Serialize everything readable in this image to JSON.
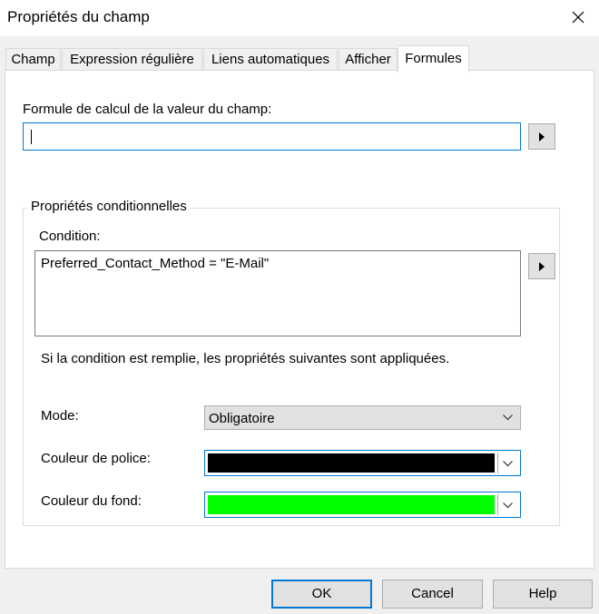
{
  "window": {
    "title": "Propriétés du champ"
  },
  "tabs": [
    {
      "label": "Champ"
    },
    {
      "label": "Expression régulière"
    },
    {
      "label": "Liens automatiques"
    },
    {
      "label": "Afficher"
    },
    {
      "label": "Formules"
    }
  ],
  "formula": {
    "label": "Formule de calcul de la valeur du champ:",
    "value": ""
  },
  "conditional": {
    "group_title": "Propriétés conditionnelles",
    "condition_label": "Condition:",
    "condition_value": "Preferred_Contact_Method = \"E-Mail\"",
    "info_text": "Si la condition est remplie, les propriétés suivantes sont appliquées.",
    "mode_label": "Mode:",
    "mode_value": "Obligatoire",
    "font_color_label": "Couleur de police:",
    "font_color": "#000000",
    "bg_color_label": "Couleur du fond:",
    "bg_color": "#00ff00"
  },
  "buttons": {
    "ok": "OK",
    "cancel": "Cancel",
    "help": "Help"
  },
  "icons": {
    "close": "close-icon",
    "arrow": "arrow-right-icon",
    "dropdown": "chevron-down-icon"
  }
}
